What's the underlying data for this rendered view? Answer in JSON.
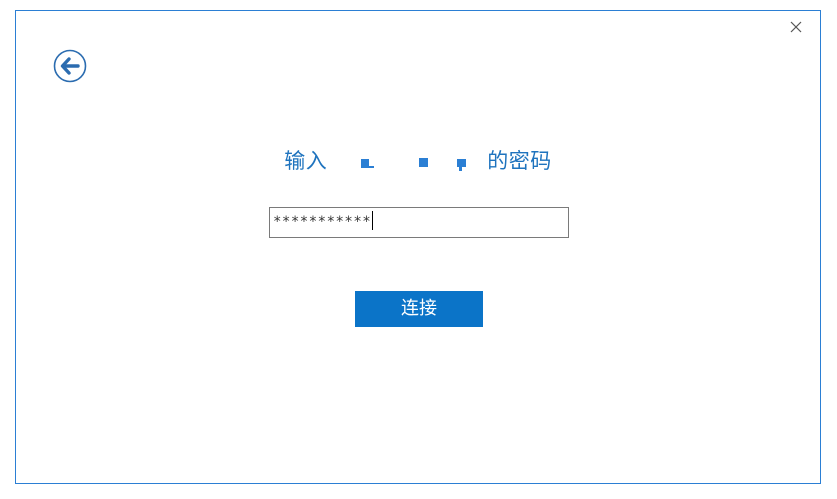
{
  "dialog": {
    "title_prefix": "输入",
    "title_suffix": "的密码",
    "password_value": "***********",
    "connect_label": "连接"
  },
  "icons": {
    "back": "back-arrow-icon",
    "close": "close-icon"
  },
  "colors": {
    "accent": "#1e73be",
    "button": "#0b74c8",
    "border": "#2b7fd4"
  }
}
